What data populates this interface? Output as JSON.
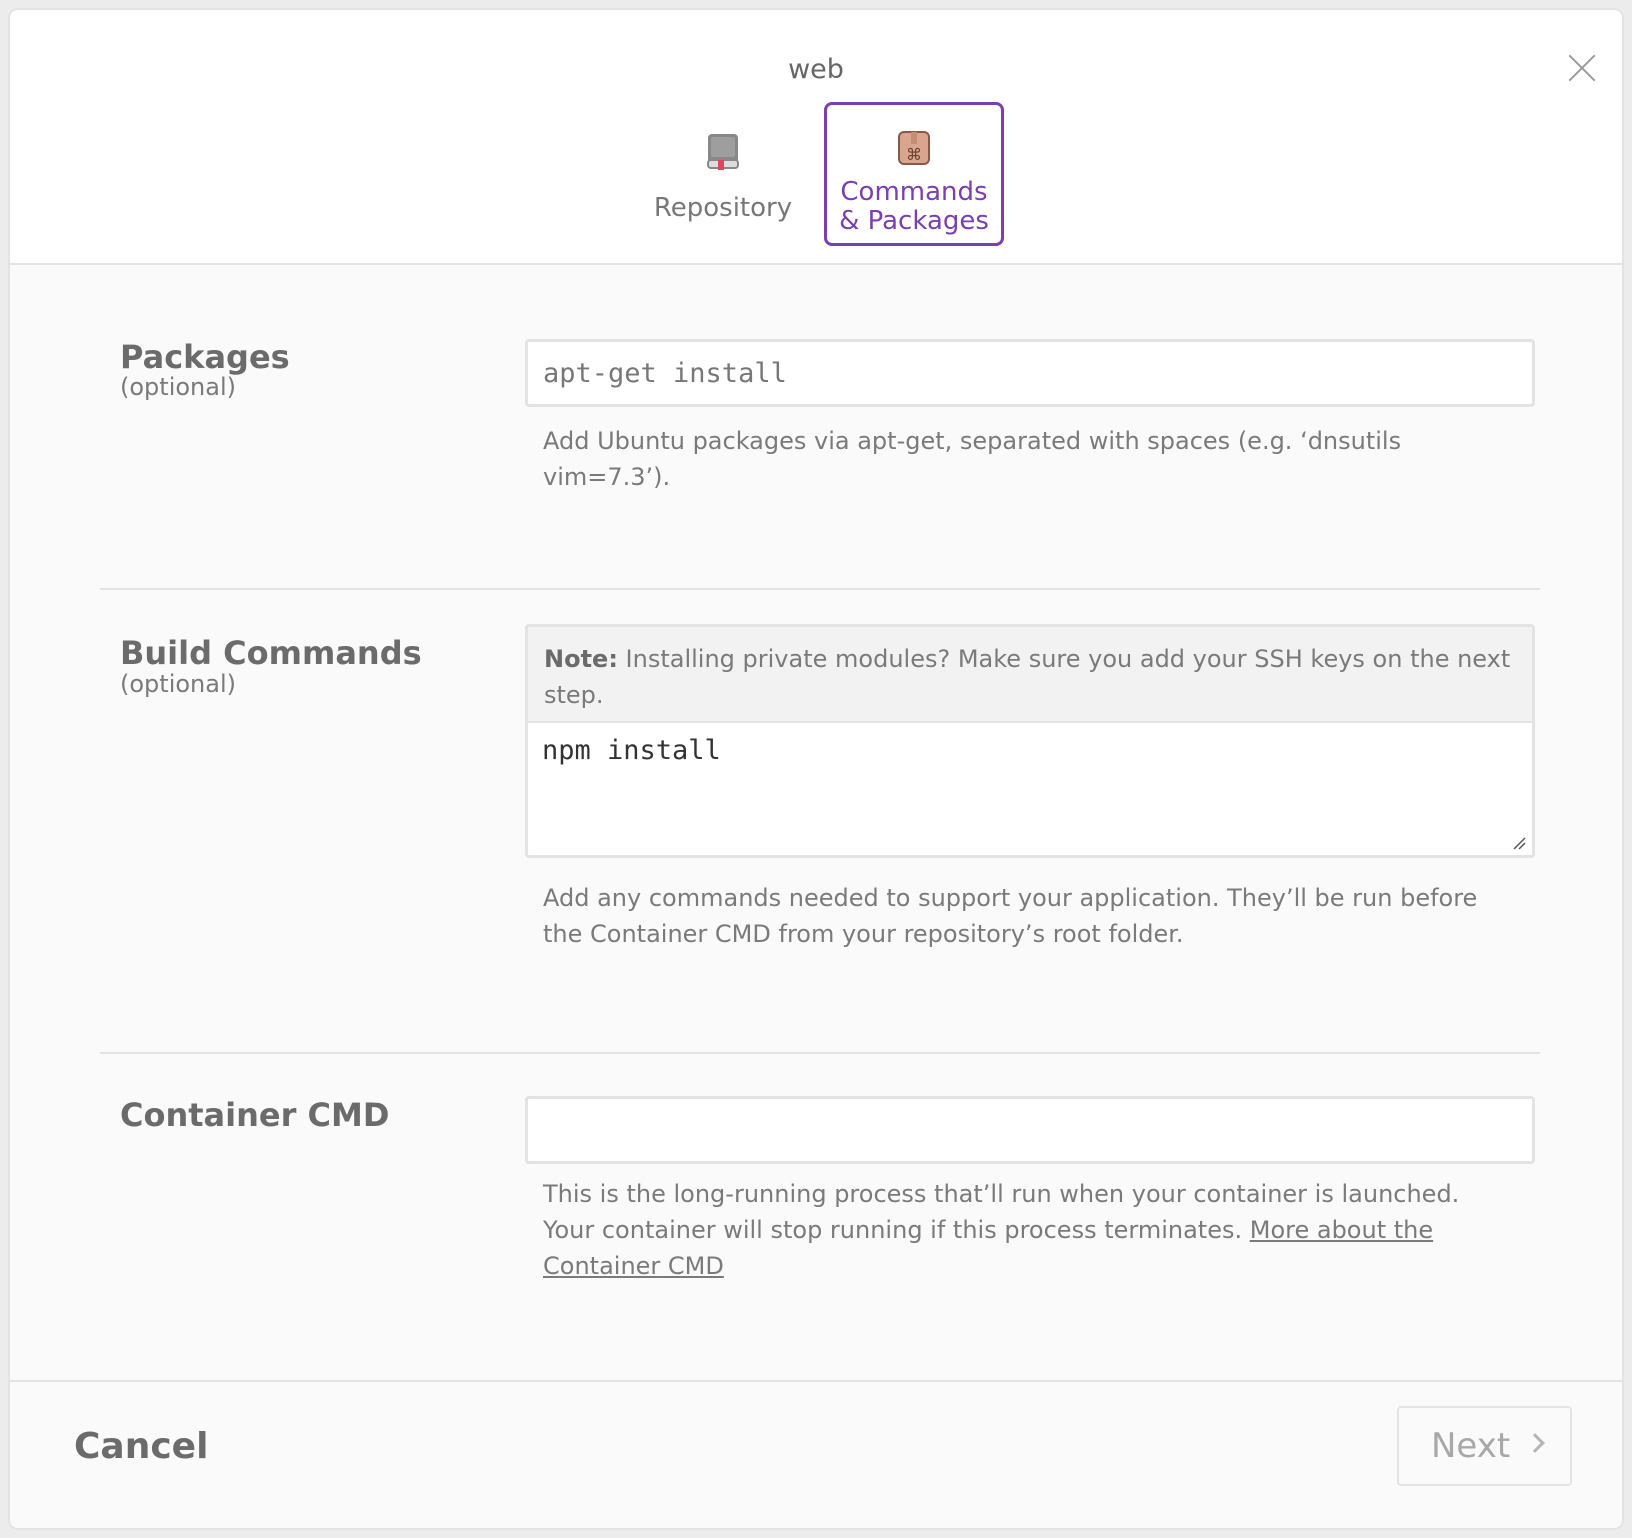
{
  "modal": {
    "title": "web"
  },
  "tabs": [
    {
      "label": "Repository",
      "icon": "book-icon",
      "active": false
    },
    {
      "label": "Commands\n& Packages",
      "label_line1": "Commands",
      "label_line2": "& Packages",
      "icon": "package-icon",
      "active": true
    }
  ],
  "packages": {
    "label": "Packages",
    "sublabel": "(optional)",
    "value": "",
    "placeholder": "apt-get install",
    "help": "Add Ubuntu packages via apt-get, separated with spaces (e.g. ‘dnsutils vim=7.3’)."
  },
  "build_commands": {
    "label": "Build Commands",
    "sublabel": "(optional)",
    "note_bold": "Note:",
    "note_text": " Installing private modules? Make sure you add your SSH keys on the next step.",
    "value": "npm install",
    "help": "Add any commands needed to support your application. They’ll be run before the Container CMD from your repository’s root folder."
  },
  "container_cmd": {
    "label": "Container CMD",
    "value": "",
    "help": "This is the long-running process that’ll run when your container is launched. Your container will stop running if this process terminates. ",
    "link_text": "More about the Container CMD"
  },
  "footer": {
    "cancel_label": "Cancel",
    "next_label": "Next"
  },
  "colors": {
    "accent": "#7b3fae",
    "text": "#6b6b6b",
    "border": "#e3e3e3"
  }
}
